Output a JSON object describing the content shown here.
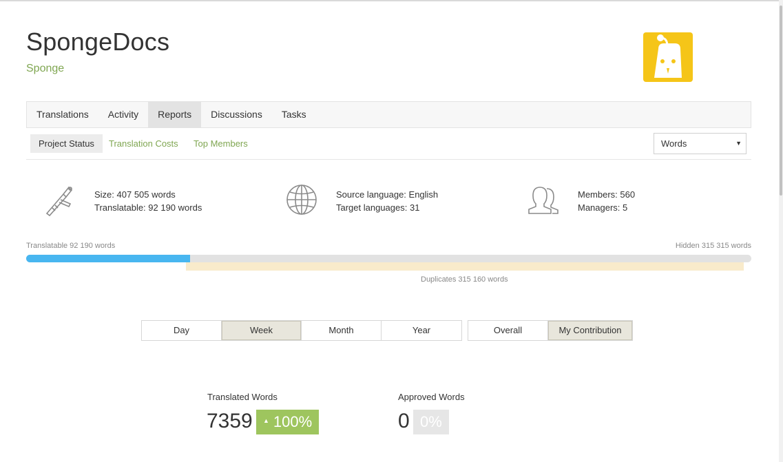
{
  "project": {
    "title": "SpongeDocs",
    "owner": "Sponge"
  },
  "tabs": [
    {
      "label": "Translations",
      "active": false
    },
    {
      "label": "Activity",
      "active": false
    },
    {
      "label": "Reports",
      "active": true
    },
    {
      "label": "Discussions",
      "active": false
    },
    {
      "label": "Tasks",
      "active": false
    }
  ],
  "subtabs": [
    {
      "label": "Project Status",
      "active": true
    },
    {
      "label": "Translation Costs",
      "active": false
    },
    {
      "label": "Top Members",
      "active": false
    }
  ],
  "unit_select": {
    "value": "Words"
  },
  "stats": {
    "size": "Size: 407 505 words",
    "translatable": "Translatable: 92 190 words",
    "source_language": "Source language: English",
    "target_languages": "Target languages: 31",
    "members": "Members: 560",
    "managers": "Managers: 5"
  },
  "progress": {
    "translatable_label": "Translatable 92 190 words",
    "hidden_label": "Hidden 315 315 words",
    "duplicates_label": "Duplicates 315 160 words",
    "translatable_words": 92190,
    "total_words": 407505
  },
  "period_buttons": [
    {
      "label": "Day",
      "active": false
    },
    {
      "label": "Week",
      "active": true
    },
    {
      "label": "Month",
      "active": false
    },
    {
      "label": "Year",
      "active": false
    }
  ],
  "scope_buttons": [
    {
      "label": "Overall",
      "active": false
    },
    {
      "label": "My Contribution",
      "active": true
    }
  ],
  "metrics": {
    "translated": {
      "label": "Translated Words",
      "value": "7359",
      "change": "100%"
    },
    "approved": {
      "label": "Approved Words",
      "value": "0",
      "change": "0%"
    }
  },
  "colors": {
    "accent_green": "#7fa651",
    "progress_blue": "#48b6f0",
    "badge_green": "#9ec55e",
    "logo_yellow": "#f5c518"
  }
}
